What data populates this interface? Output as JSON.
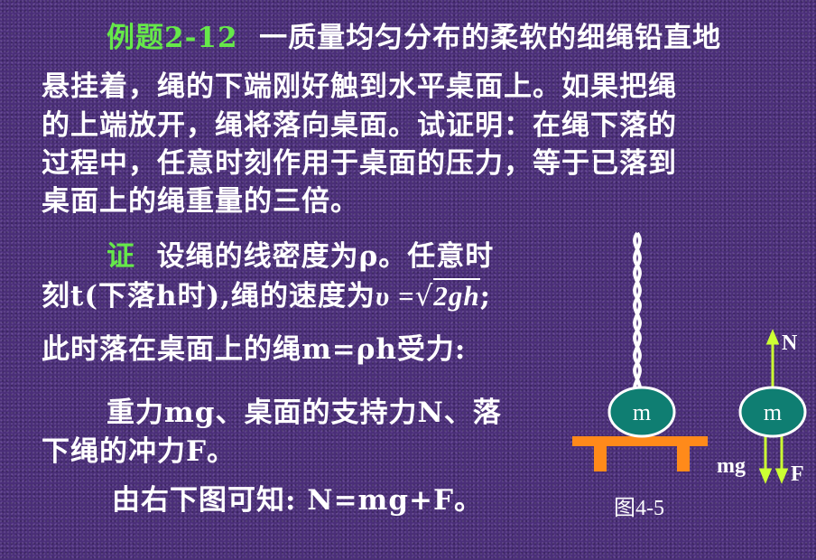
{
  "example": {
    "label": "例题2-12",
    "line1": "一质量均匀分布的柔软的细绳铅直地",
    "line2": "悬挂着，绳的下端刚好触到水平桌面上。如果把绳",
    "line3": "的上端放开，绳将落向桌面。试证明：在绳下落的",
    "line4": "过程中，任意时刻作用于桌面的压力，等于已落到",
    "line5": "桌面上的绳重量的三倍。"
  },
  "proof": {
    "label": "证",
    "line1": "设绳的线密度为ρ。任意时",
    "line2_a": "刻t(下落h时),绳的速度为",
    "line2_eq_v": "υ =",
    "line2_eq_root": "2gh",
    "line2_end": ";",
    "line3": "此时落在桌面上的绳m=ρh受力:",
    "line4": "重力mg、桌面的支持力N、落",
    "line5": "下绳的冲力F。",
    "line6": "由右下图可知: N=mg+F。"
  },
  "figure": {
    "mass_label_left": "m",
    "mass_label_right": "m",
    "force_n": "N",
    "force_mg": "mg",
    "force_f": "F",
    "caption": "图4-5"
  },
  "colors": {
    "background": "#4a2e78",
    "highlight": "#66e84a",
    "mass_fill": "#0f7e72",
    "table": "#ff8a1a",
    "arrow": "#ccff33"
  }
}
